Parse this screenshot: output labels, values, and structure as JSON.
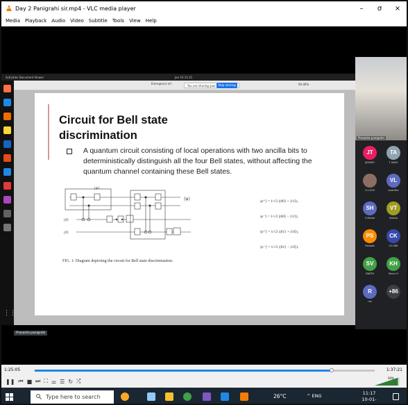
{
  "window": {
    "title": "Day 2 Panigrahi sir.mp4 - VLC media player",
    "minimize": "–",
    "maximize": "σ",
    "close": "×"
  },
  "menu": [
    "Media",
    "Playback",
    "Audio",
    "Video",
    "Subtitle",
    "Tools",
    "View",
    "Help"
  ],
  "meeting": {
    "left_label": "Activities   Document Viewer",
    "center_label": "Jan 10  11:21",
    "toolbar_page": "Emergence of i",
    "share_notice": "You are sharing your entire screen.",
    "stop_label": "Stop sharing",
    "zoom": "90.46%",
    "presenter_tag": "Prasanta panigrahi",
    "speaker_name": "Prasanta panigrahi"
  },
  "slide": {
    "title": "Circuit for Bell state discrimination",
    "bullet": "A quantum circuit consisting of local operations with two ancilla bits to deterministically distinguish all the four Bell states, without affecting the quantum channel containing these Bell states.",
    "caption": "FIG. 1: Diagram depicting the circuit for Bell state discrimination.",
    "circuit_labels": {
      "input": "|ψ⟩",
      "a1": "|0⟩",
      "a2": "|0⟩",
      "output": "|ψ⟩"
    },
    "equations": [
      "|φ⁺⟩ = 1/√2 (|00⟩ + |11⟩),",
      "|φ⁻⟩ = 1/√2 (|00⟩ − |11⟩),",
      "|ψ⁺⟩ = 1/√2 (|01⟩ + |10⟩),",
      "|ψ⁻⟩ = 1/√2 (|01⟩ − |10⟩)."
    ]
  },
  "participants": [
    {
      "initials": "JT",
      "name": "JIJSHMO",
      "color": "#e91e63"
    },
    {
      "initials": "TA",
      "name": "T ANUS",
      "color": "#90a4ae"
    },
    {
      "initials": "",
      "name": "G.L.N.M",
      "color": "#8d6e63"
    },
    {
      "initials": "VL",
      "name": "sowritha",
      "color": "#5c6bc0"
    },
    {
      "initials": "SH",
      "name": "S Mahai",
      "color": "#5c6bc0"
    },
    {
      "initials": "VT",
      "name": "Yesitha",
      "color": "#9e9d24"
    },
    {
      "initials": "PS",
      "name": "Pedadis",
      "color": "#fb8c00"
    },
    {
      "initials": "CK",
      "name": "CH SIRI",
      "color": "#3949ab"
    },
    {
      "initials": "SV",
      "name": "SWATH",
      "color": "#43a047"
    },
    {
      "initials": "KH",
      "name": "Kavur H",
      "color": "#43a047"
    },
    {
      "initials": "R",
      "name": "ros",
      "color": "#5c6bc0"
    },
    {
      "initials": "+86",
      "name": "",
      "color": "#3c4043"
    }
  ],
  "player": {
    "elapsed": "1:25:05",
    "total": "1:37:21",
    "progress": 0.874,
    "volume_label": "93%",
    "volume": 0.93,
    "controls": [
      "pause",
      "prev",
      "stop",
      "next",
      "fullscreen",
      "ext",
      "playlist",
      "loop",
      "random"
    ]
  },
  "taskbar": {
    "search_placeholder": "Type here to search",
    "weather": "26°C",
    "tray": "^  ENG",
    "time": "11:17",
    "date": "10-01-2024"
  },
  "colors": {
    "vlc_orange": "#f57c00",
    "accent_blue": "#1e88e5",
    "taskbar_bg": "#1b2633"
  }
}
